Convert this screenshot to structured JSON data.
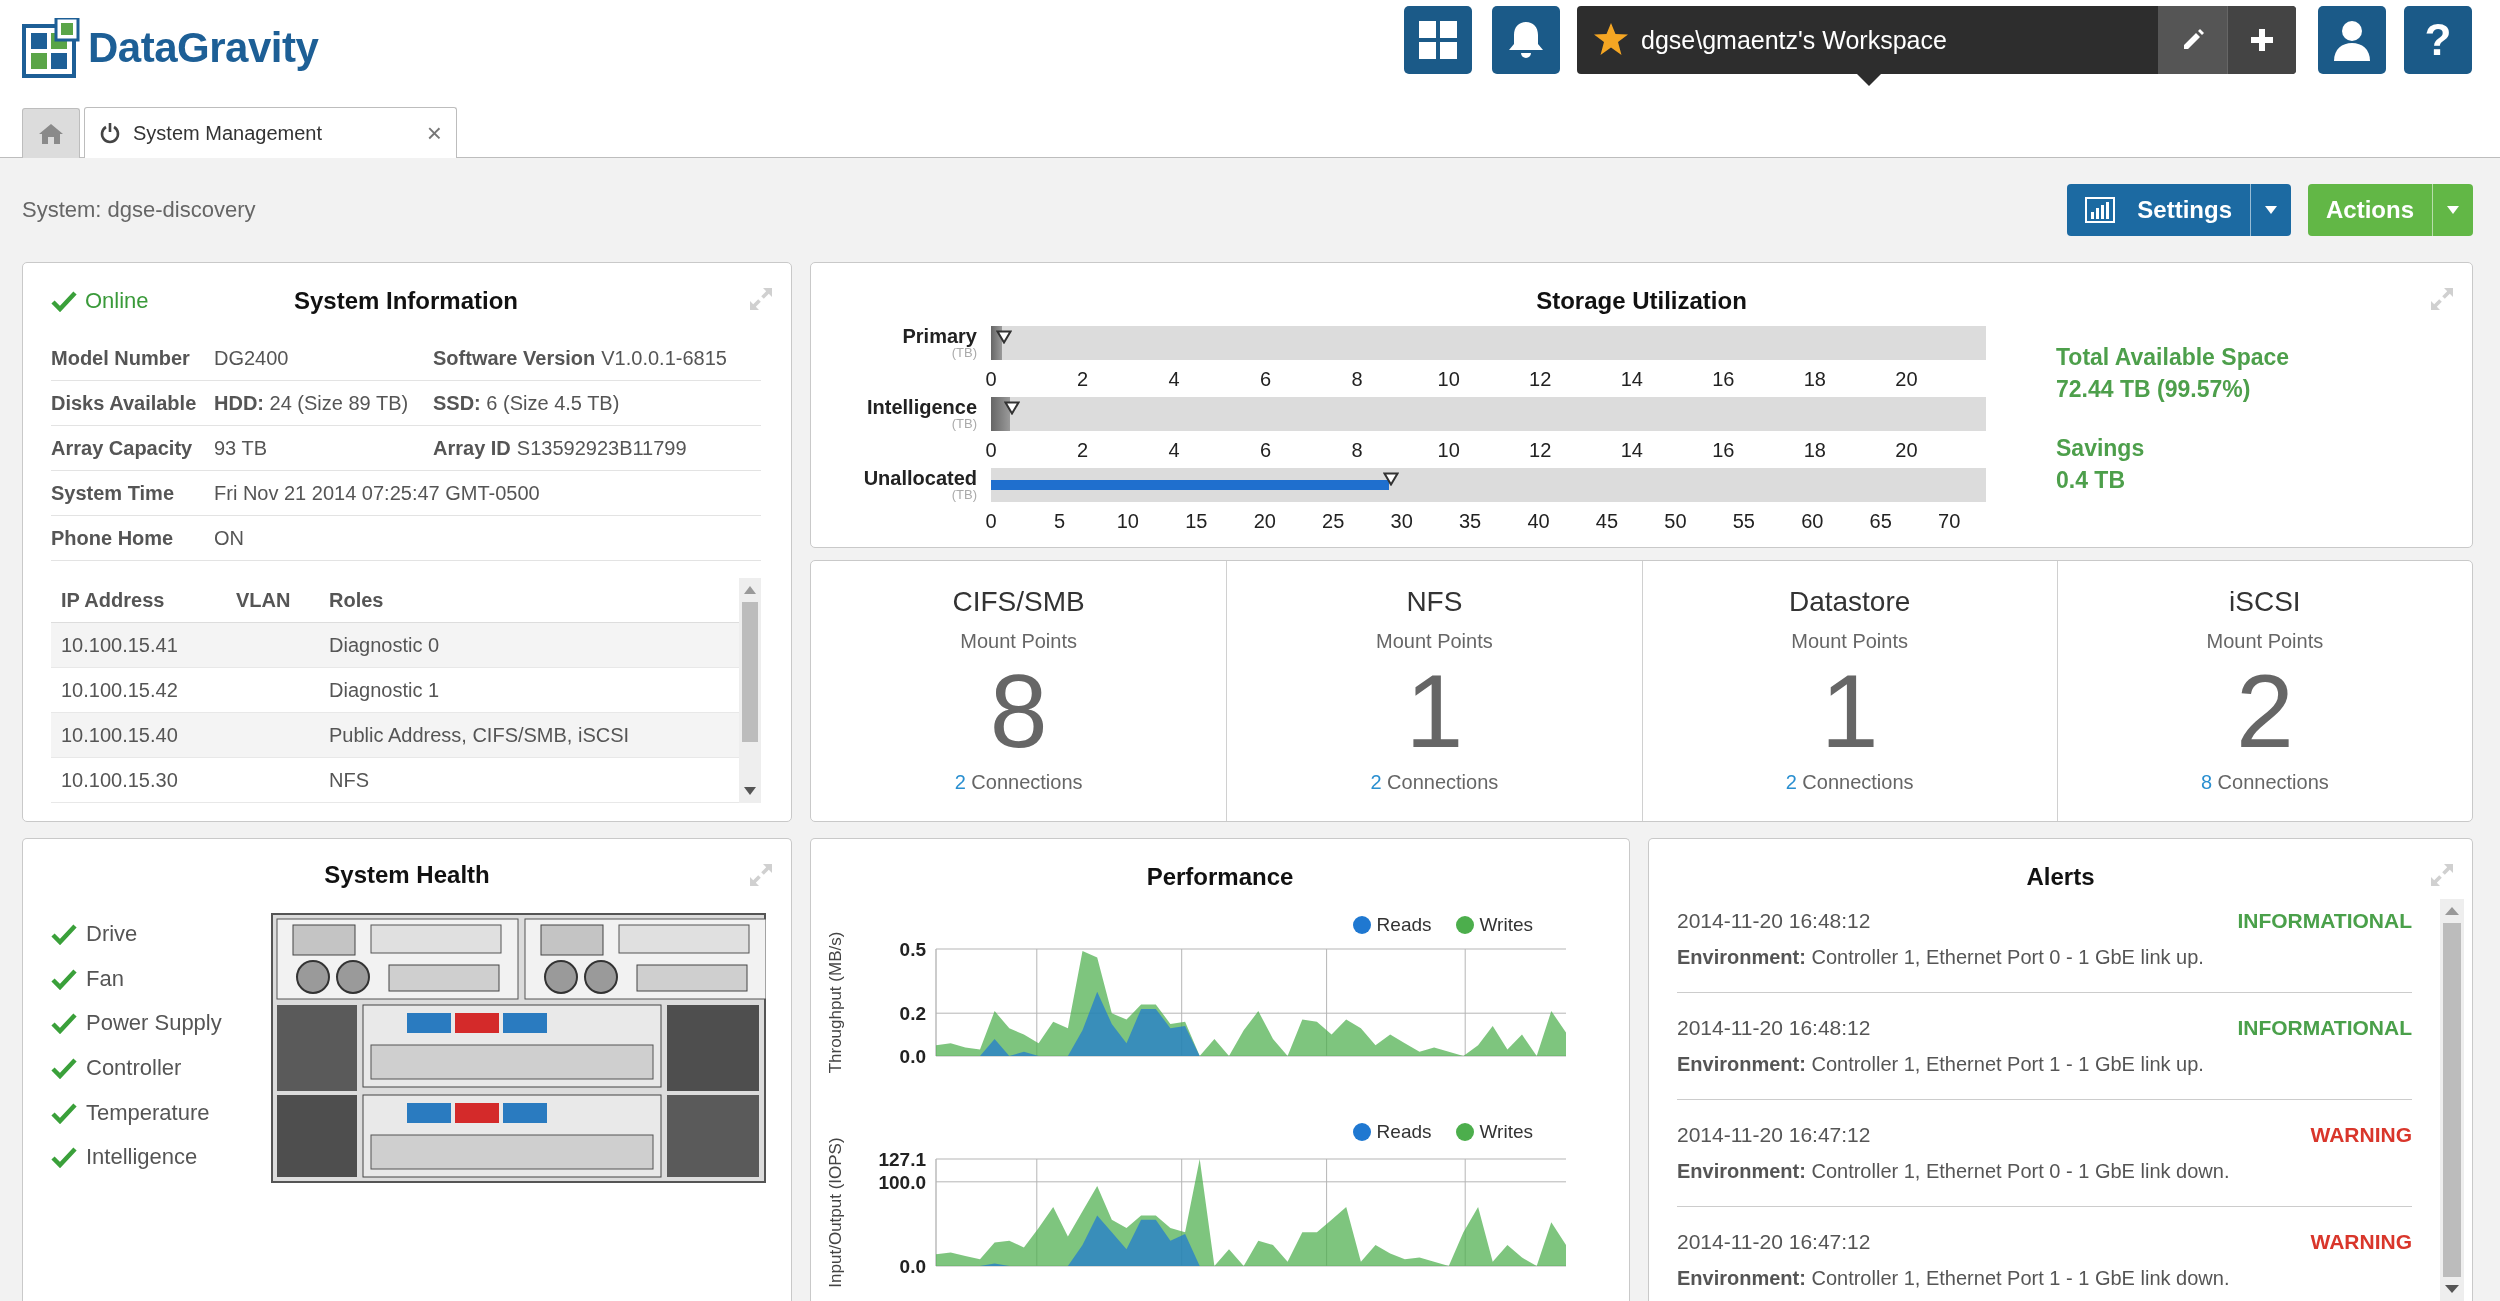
{
  "header": {
    "logo": "DataGravity",
    "workspace": "dgse\\gmaentz's Workspace",
    "help_label": "?"
  },
  "tabs": [
    {
      "kind": "home",
      "selected": false
    },
    {
      "kind": "page",
      "label": "System Management",
      "close_label": "×",
      "selected": true
    }
  ],
  "system_label": "System: dgse-discovery",
  "toolbar": [
    {
      "kind": "settings",
      "label": "Settings"
    },
    {
      "kind": "actions",
      "label": "Actions"
    }
  ],
  "system_information": {
    "title": "System Information",
    "status": {
      "label": "Online",
      "online": true
    },
    "fields": [
      {
        "label": "Model Number",
        "value": "DG2400",
        "label_2": "Software Version",
        "value_2": "V1.0.0.1-6815"
      },
      {
        "label": "Disks Available",
        "value": "**HDD:** 24 (Size 89 TB)",
        "value_2": "**SSD:** 6 (Size 4.5 TB)"
      },
      {
        "label": "Array Capacity",
        "value": "93 TB",
        "label_2": "Array ID",
        "value_2": "S13592923B11799"
      },
      {
        "label": "System Time",
        "value": "Fri Nov 21 2014 07:25:47 GMT-0500"
      },
      {
        "label": "Phone Home",
        "value": "ON"
      }
    ],
    "ip_table": {
      "columns": [
        "IP Address",
        "VLAN",
        "Roles"
      ],
      "rows": [
        {
          "ip": "10.100.15.41",
          "roles": "Diagnostic 0"
        },
        {
          "ip": "10.100.15.42",
          "roles": "Diagnostic 1"
        },
        {
          "ip": "10.100.15.40",
          "roles": "Public Address, CIFS/SMB, iSCSI"
        },
        {
          "ip": "10.100.15.30",
          "roles": "NFS"
        }
      ]
    }
  },
  "storage_utilization": {
    "title": "Storage Utilization",
    "rows": [
      {
        "kind": "tier",
        "label": "Primary",
        "unit": "(TB)",
        "level": 0.011,
        "ticks": [
          "0",
          "2",
          "4",
          "6",
          "8",
          "10",
          "12",
          "14",
          "16",
          "18",
          "20"
        ]
      },
      {
        "kind": "tier",
        "label": "Intelligence",
        "unit": "(TB)",
        "level": 0.019,
        "ticks": [
          "0",
          "2",
          "4",
          "6",
          "8",
          "10",
          "12",
          "14",
          "16",
          "18",
          "20"
        ]
      },
      {
        "kind": "unallocated",
        "label": "Unallocated",
        "unit": "(TB)",
        "level": 0.4,
        "ticks": [
          "0",
          "5",
          "10",
          "15",
          "20",
          "25",
          "30",
          "35",
          "40",
          "45",
          "50",
          "55",
          "60",
          "65",
          "70"
        ]
      }
    ],
    "summary": [
      {
        "label": "Total Available Space",
        "value": "72.44 TB (99.57%)"
      },
      {
        "label": "Savings",
        "value": "0.4 TB"
      }
    ]
  },
  "mount_points": [
    {
      "name": "CIFS/SMB",
      "subtitle": "Mount Points",
      "count": "8",
      "connections": "2",
      "connections_label": "Connections"
    },
    {
      "name": "NFS",
      "subtitle": "Mount Points",
      "count": "1",
      "connections": "2",
      "connections_label": "Connections"
    },
    {
      "name": "Datastore",
      "subtitle": "Mount Points",
      "count": "1",
      "connections": "2",
      "connections_label": "Connections"
    },
    {
      "name": "iSCSI",
      "subtitle": "Mount Points",
      "count": "2",
      "connections": "8",
      "connections_label": "Connections"
    }
  ],
  "system_health": {
    "title": "System Health",
    "items": [
      {
        "label": "Drive",
        "ok": true
      },
      {
        "label": "Fan",
        "ok": true
      },
      {
        "label": "Power Supply",
        "ok": true
      },
      {
        "label": "Controller",
        "ok": true
      },
      {
        "label": "Temperature",
        "ok": true
      },
      {
        "label": "Intelligence",
        "ok": true
      }
    ]
  },
  "performance": {
    "title": "Performance",
    "charts": [
      {
        "chart_data": {
          "type": "area",
          "ylabel": "Throughput (MB/s)",
          "grid": true,
          "ylim": [
            0,
            0.5
          ],
          "yticks": [
            {
              "value": 0,
              "label": "0.0"
            },
            {
              "value": 0.2,
              "label": "0.2"
            },
            {
              "value": 0.5,
              "label": "0.5"
            }
          ],
          "stacked": false,
          "series": [
            {
              "name": "Reads",
              "color": "#1f78d1",
              "values": [
                0,
                0,
                0,
                0,
                0.08,
                0,
                0.02,
                0,
                0,
                0,
                0.12,
                0.3,
                0.15,
                0.06,
                0.22,
                0.22,
                0.13,
                0.14,
                0,
                0,
                0,
                0,
                0,
                0,
                0,
                0,
                0,
                0,
                0,
                0,
                0,
                0,
                0,
                0,
                0,
                0,
                0,
                0,
                0,
                0,
                0,
                0,
                0,
                0
              ]
            },
            {
              "name": "Writes",
              "color": "#4cae4c",
              "values": [
                0.05,
                0.06,
                0.04,
                0.03,
                0.21,
                0.13,
                0.1,
                0.06,
                0.16,
                0.13,
                0.49,
                0.46,
                0.2,
                0.17,
                0.24,
                0.24,
                0.15,
                0.16,
                0,
                0.08,
                0,
                0.12,
                0.21,
                0.08,
                0,
                0.17,
                0.16,
                0.1,
                0.17,
                0.13,
                0.05,
                0.1,
                0.06,
                0.02,
                0.04,
                0.02,
                0,
                0.05,
                0.14,
                0.03,
                0.1,
                0,
                0.21,
                0.11
              ]
            }
          ]
        }
      },
      {
        "chart_data": {
          "type": "area",
          "ylabel": "Input/Output (IOPS)",
          "grid": true,
          "ylim": [
            0,
            127.1
          ],
          "yticks": [
            {
              "value": 0,
              "label": "0.0"
            },
            {
              "value": 100,
              "label": "100.0"
            },
            {
              "value": 127.1,
              "label": "127.1"
            }
          ],
          "stacked": false,
          "series": [
            {
              "name": "Reads",
              "color": "#1f78d1",
              "values": [
                0,
                0,
                0,
                0,
                3,
                0,
                0,
                0,
                0,
                0,
                25,
                60,
                40,
                20,
                55,
                55,
                30,
                38,
                0,
                0,
                0,
                0,
                0,
                0,
                0,
                0,
                0,
                0,
                0,
                0,
                0,
                0,
                0,
                0,
                0,
                0,
                0,
                0,
                0,
                0,
                0,
                0,
                0,
                0
              ]
            },
            {
              "name": "Writes",
              "color": "#4cae4c",
              "values": [
                14,
                16,
                12,
                8,
                28,
                30,
                22,
                45,
                70,
                35,
                65,
                95,
                55,
                45,
                60,
                60,
                45,
                40,
                127,
                0,
                20,
                0,
                30,
                25,
                5,
                40,
                40,
                55,
                70,
                5,
                25,
                15,
                8,
                10,
                5,
                0,
                40,
                70,
                5,
                25,
                10,
                0,
                52,
                25
              ]
            }
          ]
        }
      }
    ]
  },
  "alerts": {
    "title": "Alerts",
    "items": [
      {
        "time": "2014-11-20 16:48:12",
        "kind": "informational",
        "severity": "INFORMATIONAL",
        "message": "**Environment:** Controller 1, Ethernet Port 0 - 1 GbE link up."
      },
      {
        "time": "2014-11-20 16:48:12",
        "kind": "informational",
        "severity": "INFORMATIONAL",
        "message": "**Environment:** Controller 1, Ethernet Port 1 - 1 GbE link up."
      },
      {
        "time": "2014-11-20 16:47:12",
        "kind": "warning",
        "severity": "WARNING",
        "message": "**Environment:** Controller 1, Ethernet Port 0 - 1 GbE link down."
      },
      {
        "time": "2014-11-20 16:47:12",
        "kind": "warning",
        "severity": "WARNING",
        "message": "**Environment:** Controller 1, Ethernet Port 1 - 1 GbE link down."
      }
    ]
  }
}
